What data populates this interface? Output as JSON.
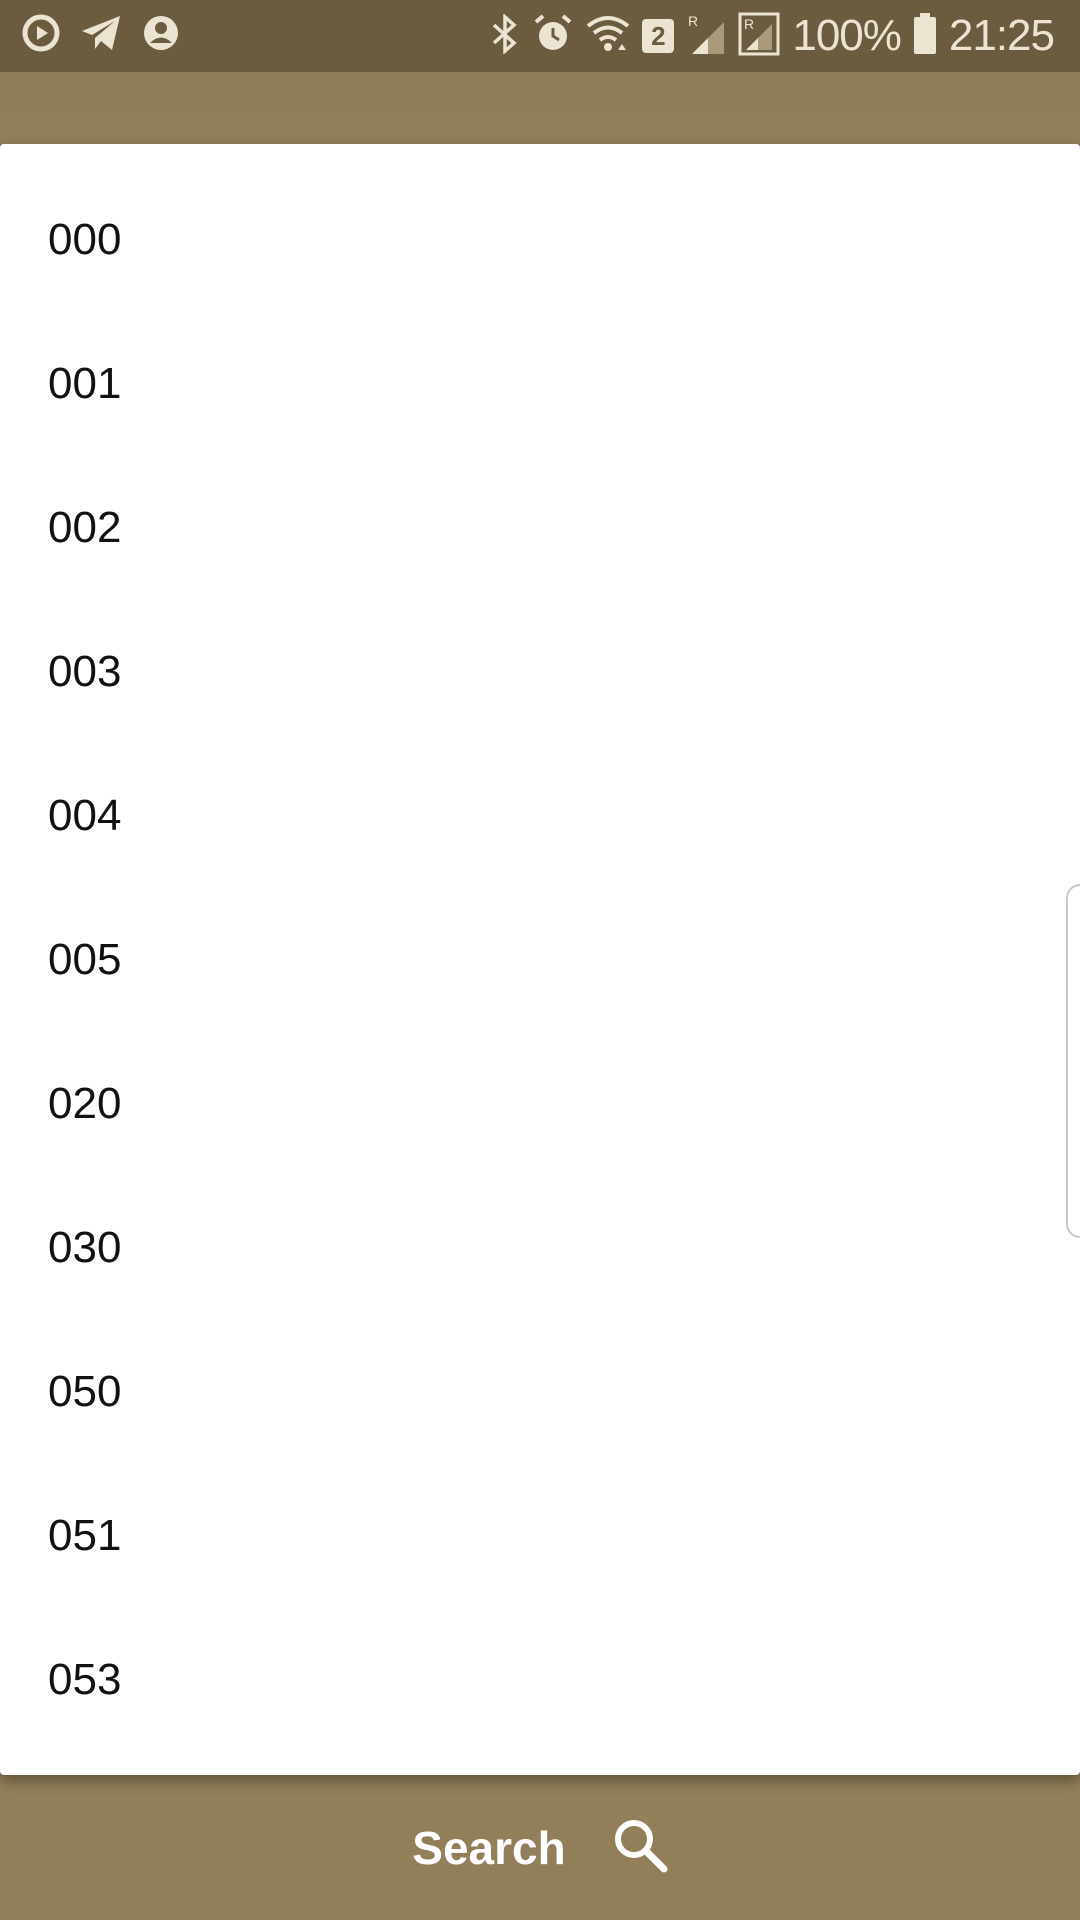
{
  "status_bar": {
    "left_icons": [
      "play-circle-icon",
      "telegram-icon",
      "account-circle-icon"
    ],
    "right_icons": [
      "bluetooth-icon",
      "alarm-icon",
      "wifi-icon",
      "sim-badge-icon",
      "signal-roaming-icon",
      "signal-roaming-2-icon",
      "battery-icon"
    ],
    "sim_badge": "2",
    "battery_percent": "100%",
    "time": "21:25"
  },
  "dropdown": {
    "items": [
      "000",
      "001",
      "002",
      "003",
      "004",
      "005",
      "020",
      "030",
      "050",
      "051",
      "053"
    ]
  },
  "search": {
    "label": "Search",
    "icon": "search-icon"
  },
  "colors": {
    "status_bar": "#6b5c3f",
    "app_background": "#927e59",
    "list_background": "#ffffff",
    "list_text": "#111111"
  }
}
